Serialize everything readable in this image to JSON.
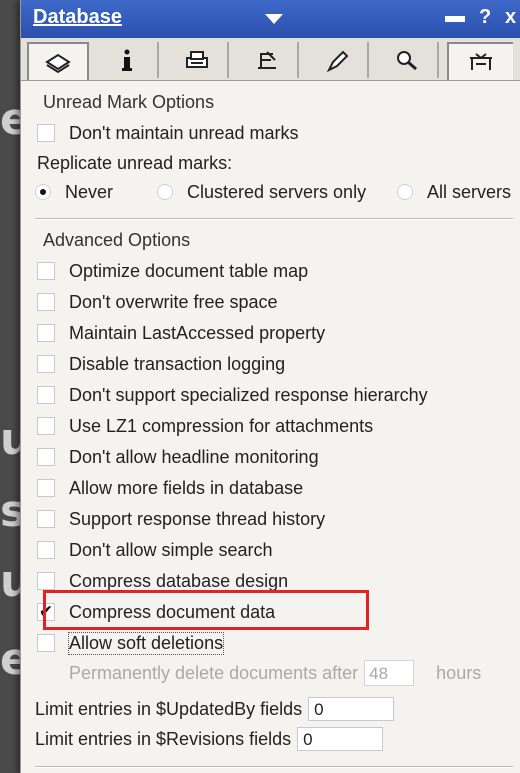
{
  "window": {
    "title": "Database",
    "help_glyph": "?",
    "close_glyph": "x"
  },
  "tabs": [
    {
      "name": "basics-tab-icon"
    },
    {
      "name": "info-tab-icon"
    },
    {
      "name": "printer-tab-icon"
    },
    {
      "name": "design-tab-icon"
    },
    {
      "name": "launch-tab-icon"
    },
    {
      "name": "search-tab-icon"
    },
    {
      "name": "advanced-tab-icon"
    }
  ],
  "unread": {
    "heading": "Unread Mark Options",
    "dont_maintain": "Don't maintain unread marks",
    "replicate_label": "Replicate unread marks:",
    "never": "Never",
    "clustered": "Clustered servers only",
    "all": "All servers",
    "selected": "Never"
  },
  "advanced": {
    "heading": "Advanced Options",
    "options": [
      {
        "label": "Optimize document table map",
        "checked": false
      },
      {
        "label": "Don't overwrite free space",
        "checked": false
      },
      {
        "label": "Maintain LastAccessed property",
        "checked": false
      },
      {
        "label": "Disable transaction logging",
        "checked": false
      },
      {
        "label": "Don't support specialized response hierarchy",
        "checked": false
      },
      {
        "label": "Use LZ1 compression for attachments",
        "checked": false
      },
      {
        "label": "Don't allow headline monitoring",
        "checked": false
      },
      {
        "label": "Allow more fields in database",
        "checked": false
      },
      {
        "label": "Support response thread history",
        "checked": false
      },
      {
        "label": "Don't allow simple search",
        "checked": false
      },
      {
        "label": "Compress database design",
        "checked": false
      },
      {
        "label": "Compress document data",
        "checked": true
      },
      {
        "label": "Allow soft deletions",
        "checked": false
      }
    ],
    "checkmark": "✔",
    "perm_delete_label": "Permanently delete documents after",
    "perm_delete_value": "48",
    "perm_delete_unit": "hours",
    "limit_updatedby_label": "Limit entries in $UpdatedBy fields",
    "limit_updatedby_value": "0",
    "limit_revisions_label": "Limit entries in $Revisions fields",
    "limit_revisions_value": "0"
  },
  "background_fragments": [
    "e",
    "u",
    "se",
    "u",
    "e"
  ]
}
